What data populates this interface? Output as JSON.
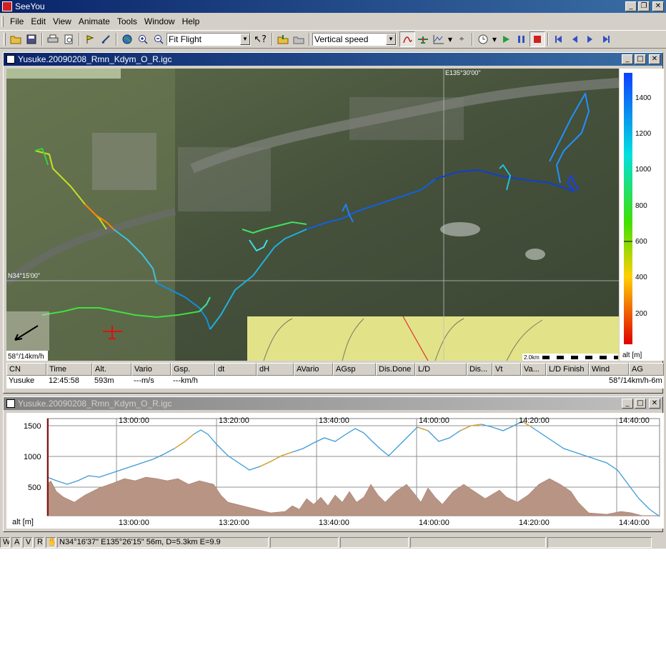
{
  "app": {
    "title": "SeeYou"
  },
  "menu": [
    "File",
    "Edit",
    "View",
    "Animate",
    "Tools",
    "Window",
    "Help"
  ],
  "toolbar": {
    "zoom_combo": "Fit Flight",
    "color_combo": "Vertical speed"
  },
  "map_window": {
    "title": "Yusuke.20090208_Rmn_Kdym_O_R.igc",
    "grid_labels": {
      "longitude": "E135°30'00\"",
      "latitude": "N34°15'00\""
    },
    "wind_label": "58°/14km/h",
    "scale_label": "2.0km",
    "legend": {
      "unit": "alt [m]",
      "ticks": [
        "1400",
        "1200",
        "1000",
        "800",
        "600",
        "400",
        "200"
      ],
      "colors": [
        "#e00000",
        "#ffd000",
        "#40e000",
        "#00e0e0",
        "#1040ff"
      ]
    }
  },
  "table": {
    "columns": [
      "CN",
      "Time",
      "Alt.",
      "Vario",
      "Gsp.",
      "dt",
      "dH",
      "AVario",
      "AGsp",
      "Dis.Done",
      "L/D",
      "Dis...",
      "Vt",
      "Va...",
      "L/D Finish",
      "Wind",
      "AG"
    ],
    "row": {
      "cn": "Yusuke",
      "time": "12:45:58",
      "alt": "593m",
      "vario": "---m/s",
      "gsp": "---km/h",
      "wind": "58°/14km/h-6m"
    }
  },
  "baro_window": {
    "title": "Yusuke.20090208_Rmn_Kdym_O_R.igc",
    "y_unit": "alt [m]",
    "y_ticks": [
      "1500",
      "1000",
      "500"
    ],
    "time_ticks": [
      "13:00:00",
      "13:20:00",
      "13:40:00",
      "14:00:00",
      "14:20:00",
      "14:40:00"
    ]
  },
  "status": {
    "modes": [
      "W",
      "A",
      "V",
      "R"
    ],
    "position": "N34°16'37\"  E135°26'15\" 56m, D=5.3km E=9.9"
  },
  "colors": {
    "titlebar": "#0a246a",
    "terrain": "#b89484",
    "flight_line": "#3c9bd6"
  }
}
